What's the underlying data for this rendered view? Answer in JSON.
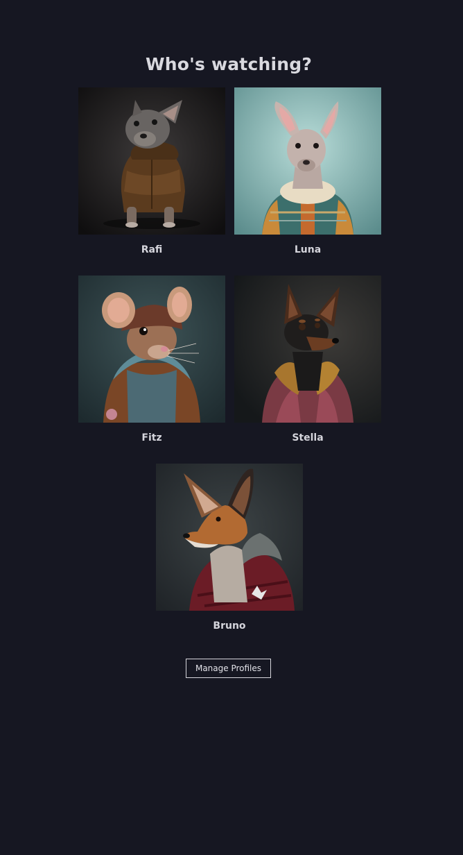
{
  "heading": "Who's watching?",
  "profiles": [
    {
      "name": "Rafi",
      "avatar_icon": "french-bulldog-in-hoodie"
    },
    {
      "name": "Luna",
      "avatar_icon": "hairless-dog-in-sweater"
    },
    {
      "name": "Fitz",
      "avatar_icon": "mouse-in-hoodie"
    },
    {
      "name": "Stella",
      "avatar_icon": "pinscher-in-jacket"
    },
    {
      "name": "Bruno",
      "avatar_icon": "fox-in-jacket"
    }
  ],
  "manage_button_label": "Manage Profiles",
  "colors": {
    "background": "#161722",
    "text": "#d9d9df",
    "button_border": "#d8d8de"
  }
}
